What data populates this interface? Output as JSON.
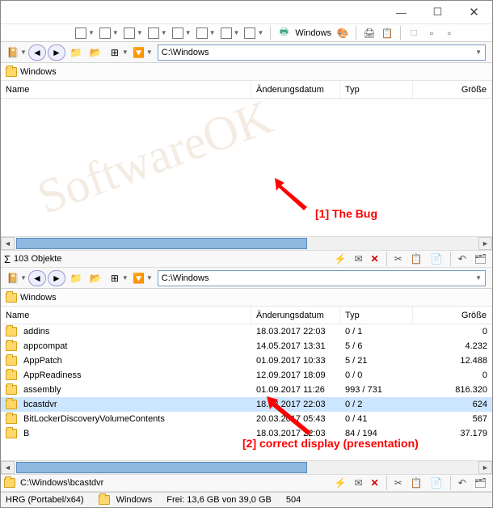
{
  "titlebar": {
    "minimize": "—",
    "maximize": "☐",
    "close": "✕"
  },
  "toolbar1_logo": "Windows",
  "pane1": {
    "address": "C:\\Windows",
    "breadcrumb": "Windows",
    "columns": {
      "name": "Name",
      "date": "Änderungsdatum",
      "typ": "Typ",
      "size": "Größe"
    },
    "status": "103 Objekte"
  },
  "pane2": {
    "address": "C:\\Windows",
    "breadcrumb": "Windows",
    "columns": {
      "name": "Name",
      "date": "Änderungsdatum",
      "typ": "Typ",
      "size": "Größe"
    },
    "rows": [
      {
        "name": "addins",
        "date": "18.03.2017 22:03",
        "typ": "0 / 1",
        "size": "0"
      },
      {
        "name": "appcompat",
        "date": "14.05.2017 13:31",
        "typ": "5 / 6",
        "size": "4.232"
      },
      {
        "name": "AppPatch",
        "date": "01.09.2017 10:33",
        "typ": "5 / 21",
        "size": "12.488"
      },
      {
        "name": "AppReadiness",
        "date": "12.09.2017 18:09",
        "typ": "0 / 0",
        "size": "0"
      },
      {
        "name": "assembly",
        "date": "01.09.2017 11:26",
        "typ": "993 / 731",
        "size": "816.320"
      },
      {
        "name": "bcastdvr",
        "date": "18.03.2017 22:03",
        "typ": "0 / 2",
        "size": "624",
        "sel": true
      },
      {
        "name": "BitLockerDiscoveryVolumeContents",
        "date": "20.03.2017 05:43",
        "typ": "0 / 41",
        "size": "567"
      },
      {
        "name": "B",
        "date": "18.03.2017 22:03",
        "typ": "84 / 194",
        "size": "37.179"
      }
    ],
    "status_path": "C:\\Windows\\bcastdvr"
  },
  "bottom": {
    "left": "HRG (Portabel/x64)",
    "mid": "Windows",
    "free": "Frei: 13,6 GB von 39,0 GB",
    "count": "504"
  },
  "annotations": {
    "a1": "[1] The Bug",
    "a2": "[2] correct display (presentation)"
  },
  "watermark": "SoftwareOK"
}
